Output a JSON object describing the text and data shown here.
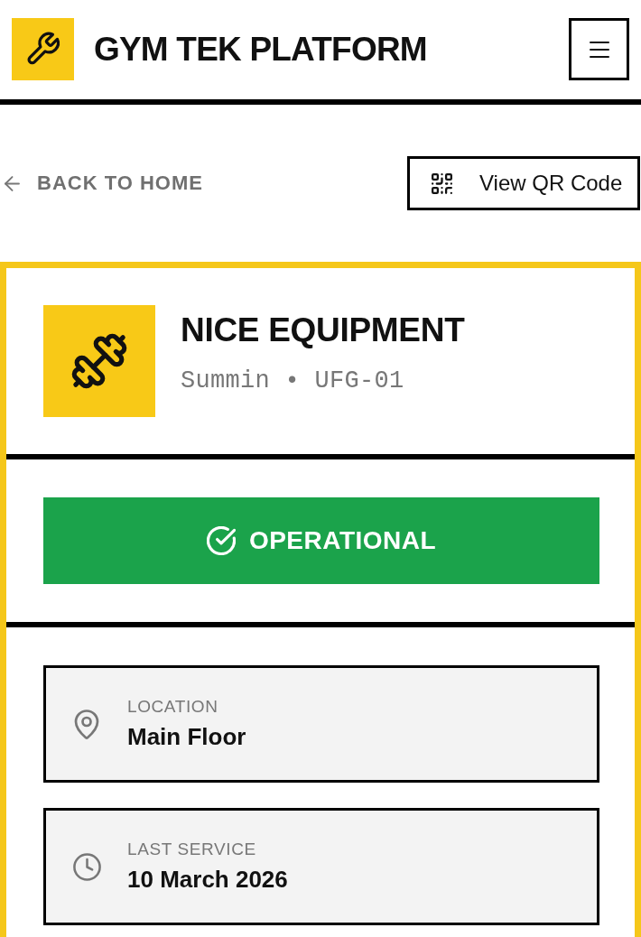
{
  "header": {
    "title": "GYM TEK PLATFORM"
  },
  "nav": {
    "back_link": "BACK TO HOME",
    "qr_button": "View QR Code"
  },
  "equipment": {
    "name": "NICE EQUIPMENT",
    "subtitle": "Summin • UFG-01"
  },
  "status": {
    "kind": "operational",
    "label": "OPERATIONAL"
  },
  "details": [
    {
      "kind": "location",
      "label": "LOCATION",
      "value": "Main Floor"
    },
    {
      "kind": "service",
      "label": "LAST SERVICE",
      "value": "10 March 2026"
    }
  ]
}
